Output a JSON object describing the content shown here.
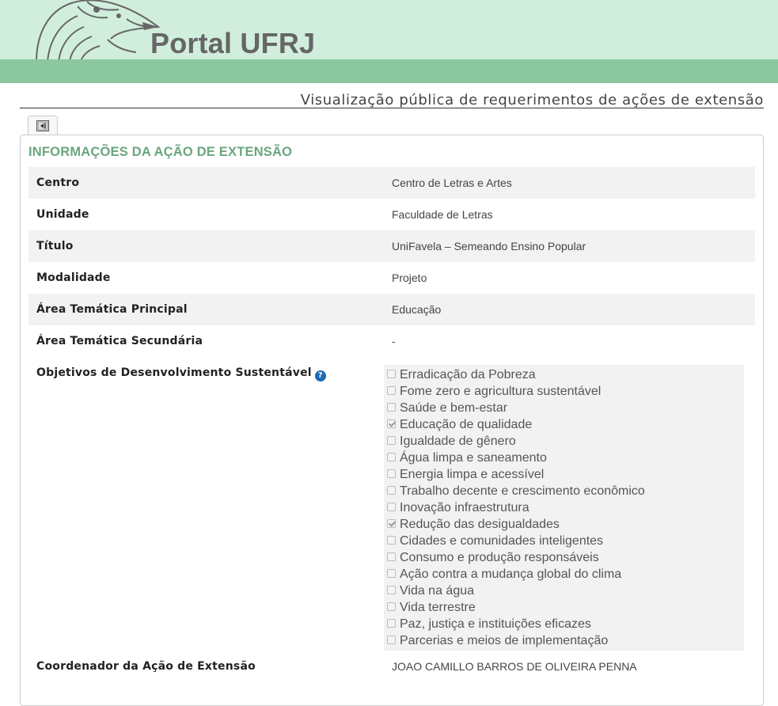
{
  "header": {
    "portal_title": "Portal UFRJ"
  },
  "page": {
    "subtitle": "Visualização pública de requerimentos de ações de extensão"
  },
  "panel": {
    "title": "INFORMAÇÕES DA AÇÃO DE EXTENSÃO",
    "rows": [
      {
        "label": "Centro",
        "value": "Centro de Letras e Artes"
      },
      {
        "label": "Unidade",
        "value": "Faculdade de Letras"
      },
      {
        "label": "Título",
        "value": "UniFavela – Semeando Ensino Popular"
      },
      {
        "label": "Modalidade",
        "value": "Projeto"
      },
      {
        "label": "Área Temática Principal",
        "value": "Educação"
      },
      {
        "label": "Área Temática Secundária",
        "value": "-"
      }
    ],
    "ods": {
      "label": "Objetivos de Desenvolvimento Sustentável",
      "help_icon": "?",
      "items": [
        {
          "label": "Erradicação da Pobreza",
          "checked": false
        },
        {
          "label": "Fome zero e agricultura sustentável",
          "checked": false
        },
        {
          "label": "Saúde e bem-estar",
          "checked": false
        },
        {
          "label": "Educação de qualidade",
          "checked": true
        },
        {
          "label": "Igualdade de gênero",
          "checked": false
        },
        {
          "label": "Água limpa e saneamento",
          "checked": false
        },
        {
          "label": "Energia limpa e acessível",
          "checked": false
        },
        {
          "label": "Trabalho decente e crescimento econômico",
          "checked": false
        },
        {
          "label": "Inovação infraestrutura",
          "checked": false
        },
        {
          "label": "Redução das desigualdades",
          "checked": true
        },
        {
          "label": "Cidades e comunidades inteligentes",
          "checked": false
        },
        {
          "label": "Consumo e produção responsáveis",
          "checked": false
        },
        {
          "label": "Ação contra a mudança global do clima",
          "checked": false
        },
        {
          "label": "Vida na água",
          "checked": false
        },
        {
          "label": "Vida terrestre",
          "checked": false
        },
        {
          "label": "Paz, justiça e instituições eficazes",
          "checked": false
        },
        {
          "label": "Parcerias e meios de implementação",
          "checked": false
        }
      ]
    },
    "coordinator": {
      "label": "Coordenador da Ação de Extensão",
      "value": "JOAO CAMILLO BARROS DE OLIVEIRA PENNA"
    }
  },
  "icons": {
    "logo": "minerva-helmet-logo",
    "tab": "panel-toggle-icon",
    "help": "help-circle-icon"
  },
  "colors": {
    "header_light": "#d1eedd",
    "header_band": "#8bc79f",
    "panel_title": "#6aa67d",
    "help_icon": "#1a6bb5"
  }
}
